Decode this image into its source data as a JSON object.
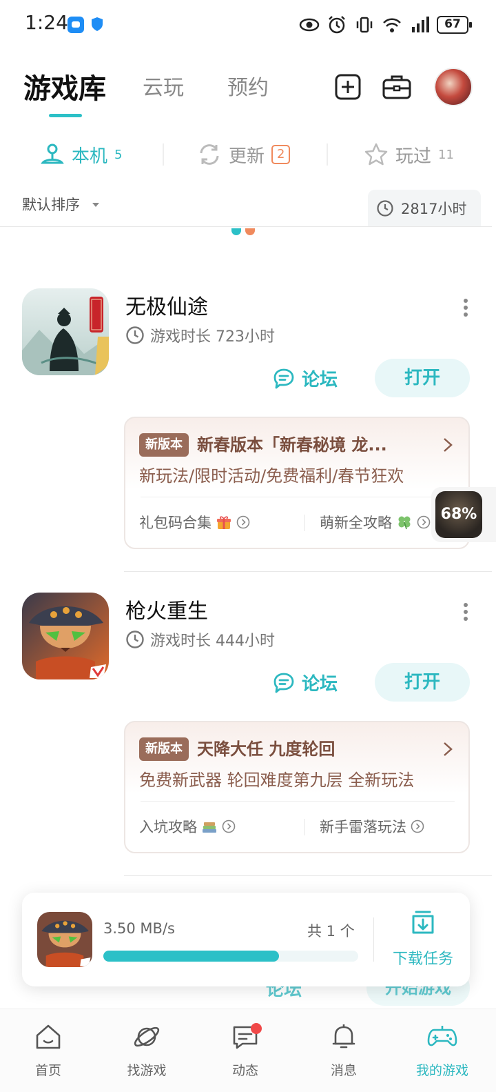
{
  "status_bar": {
    "time": "1:24",
    "battery": "67"
  },
  "header": {
    "tabs": [
      {
        "label": "游戏库",
        "active": true
      },
      {
        "label": "云玩",
        "active": false
      },
      {
        "label": "预约",
        "active": false
      }
    ]
  },
  "sub_tabs": [
    {
      "label": "本机",
      "count": "5",
      "active": true
    },
    {
      "label": "更新",
      "count": "2",
      "active": false
    },
    {
      "label": "玩过",
      "count": "11",
      "active": false
    }
  ],
  "sort": {
    "label": "默认排序"
  },
  "total_time": "2817小时",
  "games": [
    {
      "title": "无极仙途",
      "playtime": "游戏时长 723小时",
      "forum_label": "论坛",
      "open_label": "打开",
      "promo": {
        "tag": "新版本",
        "title": "新春版本「新春秘境 龙...",
        "desc": "新玩法/限时活动/免费福利/春节狂欢",
        "links": [
          "礼包码合集",
          "萌新全攻略"
        ]
      }
    },
    {
      "title": "枪火重生",
      "playtime": "游戏时长 444小时",
      "forum_label": "论坛",
      "open_label": "打开",
      "promo": {
        "tag": "新版本",
        "title": "天降大任 九度轮回",
        "desc": "免费新武器 轮回难度第九层 全新玩法",
        "links": [
          "入坑攻略",
          "新手雷落玩法"
        ]
      }
    }
  ],
  "floating_ball": {
    "percent": "68%"
  },
  "ghost_row": {
    "forum": "论坛",
    "start": "开始游戏"
  },
  "download": {
    "speed": "3.50 MB/s",
    "count_text": "共 1 个",
    "progress": 0.69,
    "task_label": "下载任务"
  },
  "bottom_nav": [
    {
      "label": "首页",
      "icon": "home-icon"
    },
    {
      "label": "找游戏",
      "icon": "planet-icon"
    },
    {
      "label": "动态",
      "icon": "chat-icon"
    },
    {
      "label": "消息",
      "icon": "bell-icon"
    },
    {
      "label": "我的游戏",
      "icon": "gamepad-icon",
      "active": true
    }
  ],
  "colors": {
    "accent": "#2cb8c0",
    "badge": "#f08a5d",
    "promo_tag": "#9a6c5a",
    "notify": "#f04848"
  }
}
